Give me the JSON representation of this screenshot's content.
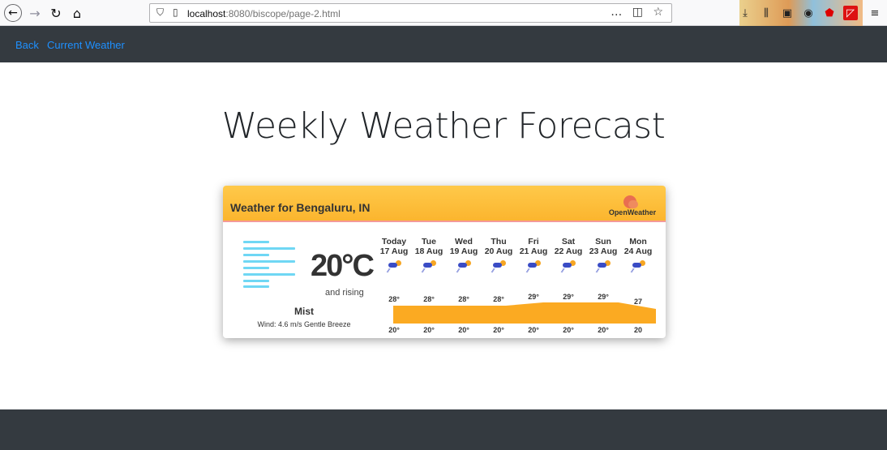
{
  "browser": {
    "url_host": "localhost",
    "url_rest": ":8080/biscope/page-2.html",
    "more_icon": "…",
    "pocket_icon": "pocket-icon",
    "star_icon": "bookmark-star-icon"
  },
  "navbar": {
    "links": [
      "Back",
      "Current Weather"
    ]
  },
  "page": {
    "title": "Weekly Weather Forecast"
  },
  "widget": {
    "title": "Weather for Bengaluru, IN",
    "logo_text": "OpenWeather",
    "current_temp": "20°C",
    "trend": "and rising",
    "condition": "Mist",
    "wind": "Wind: 4.6 m/s Gentle Breeze",
    "days": [
      {
        "name": "Today",
        "date": "17 Aug",
        "max": "28°",
        "min": "20°",
        "max_value": 28
      },
      {
        "name": "Tue",
        "date": "18 Aug",
        "max": "28°",
        "min": "20°",
        "max_value": 28
      },
      {
        "name": "Wed",
        "date": "19 Aug",
        "max": "28°",
        "min": "20°",
        "max_value": 28
      },
      {
        "name": "Thu",
        "date": "20 Aug",
        "max": "28°",
        "min": "20°",
        "max_value": 28
      },
      {
        "name": "Fri",
        "date": "21 Aug",
        "max": "29°",
        "min": "20°",
        "max_value": 29
      },
      {
        "name": "Sat",
        "date": "22 Aug",
        "max": "29°",
        "min": "20°",
        "max_value": 29
      },
      {
        "name": "Sun",
        "date": "23 Aug",
        "max": "29°",
        "min": "20°",
        "max_value": 29
      },
      {
        "name": "Mon",
        "date": "24 Aug",
        "max": "27",
        "min": "20",
        "max_value": 27
      }
    ]
  },
  "colors": {
    "navbar": "#343a40",
    "link": "#1e90ff",
    "widget_header": "#fbb52e",
    "temp_band": "#fbaa22",
    "mist": "#6fd7f4"
  }
}
